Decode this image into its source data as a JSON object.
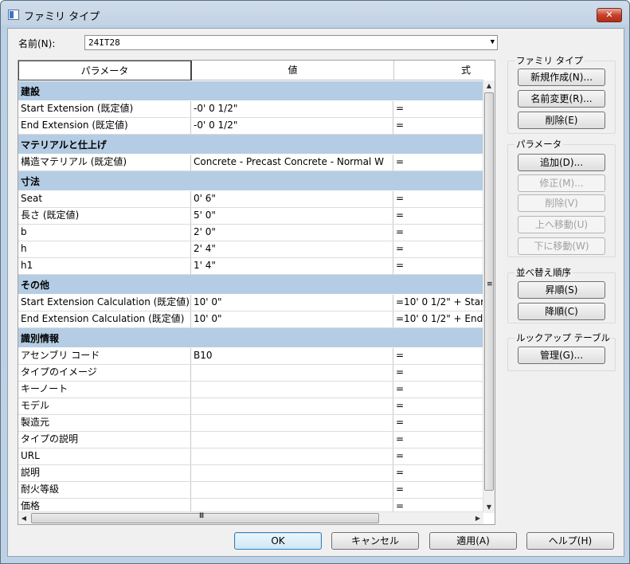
{
  "window": {
    "title": "ファミリ タイプ",
    "close_glyph": "✕"
  },
  "name_field": {
    "label": "名前(N):",
    "value": "24IT28"
  },
  "grid": {
    "headers": [
      "パラメータ",
      "値",
      "式"
    ],
    "groups": [
      {
        "name": "建設",
        "rows": [
          [
            "Start Extension (既定値)",
            "-0'  0 1/2\"",
            "="
          ],
          [
            "End Extension (既定値)",
            "-0'  0 1/2\"",
            "="
          ]
        ]
      },
      {
        "name": "マテリアルと仕上げ",
        "rows": [
          [
            "構造マテリアル (既定値)",
            "Concrete - Precast Concrete - Normal W",
            "="
          ]
        ]
      },
      {
        "name": "寸法",
        "rows": [
          [
            "Seat",
            "0'  6\"",
            "="
          ],
          [
            "長さ (既定値)",
            "5'  0\"",
            "="
          ],
          [
            "b",
            "2'  0\"",
            "="
          ],
          [
            "h",
            "2'  4\"",
            "="
          ],
          [
            "h1",
            "1'  4\"",
            "="
          ]
        ]
      },
      {
        "name": "その他",
        "rows": [
          [
            "Start Extension Calculation (既定値)",
            "10'  0\"",
            "=10'  0 1/2\" + Star"
          ],
          [
            "End Extension Calculation (既定値)",
            "10'  0\"",
            "=10'  0 1/2\" + End"
          ]
        ]
      },
      {
        "name": "識別情報",
        "rows": [
          [
            "アセンブリ コード",
            "B10",
            "="
          ],
          [
            "タイプのイメージ",
            "",
            "="
          ],
          [
            "キーノート",
            "",
            "="
          ],
          [
            "モデル",
            "",
            "="
          ],
          [
            "製造元",
            "",
            "="
          ],
          [
            "タイプの説明",
            "",
            "="
          ],
          [
            "URL",
            "",
            "="
          ],
          [
            "説明",
            "",
            "="
          ],
          [
            "耐火等級",
            "",
            "="
          ],
          [
            "価格",
            "",
            "="
          ]
        ]
      }
    ]
  },
  "family_types_panel": {
    "title": "ファミリ タイプ",
    "new": "新規作成(N)...",
    "rename": "名前変更(R)...",
    "delete": "削除(E)"
  },
  "parameters_panel": {
    "title": "パラメータ",
    "add": "追加(D)...",
    "modify": "修正(M)...",
    "remove": "削除(V)",
    "move_up": "上へ移動(U)",
    "move_down": "下に移動(W)"
  },
  "sort_panel": {
    "title": "並べ替え順序",
    "ascending": "昇順(S)",
    "descending": "降順(C)"
  },
  "lookup_panel": {
    "title": "ルックアップ テーブル",
    "manage": "管理(G)..."
  },
  "footer": {
    "ok": "OK",
    "cancel": "キャンセル",
    "apply": "適用(A)",
    "help": "ヘルプ(H)"
  },
  "icons": {
    "dropdown": "chevron-down-icon",
    "scroll_up": "triangle-up-icon",
    "scroll_down": "triangle-down-icon",
    "scroll_left": "triangle-left-icon",
    "scroll_right": "triangle-right-icon"
  }
}
